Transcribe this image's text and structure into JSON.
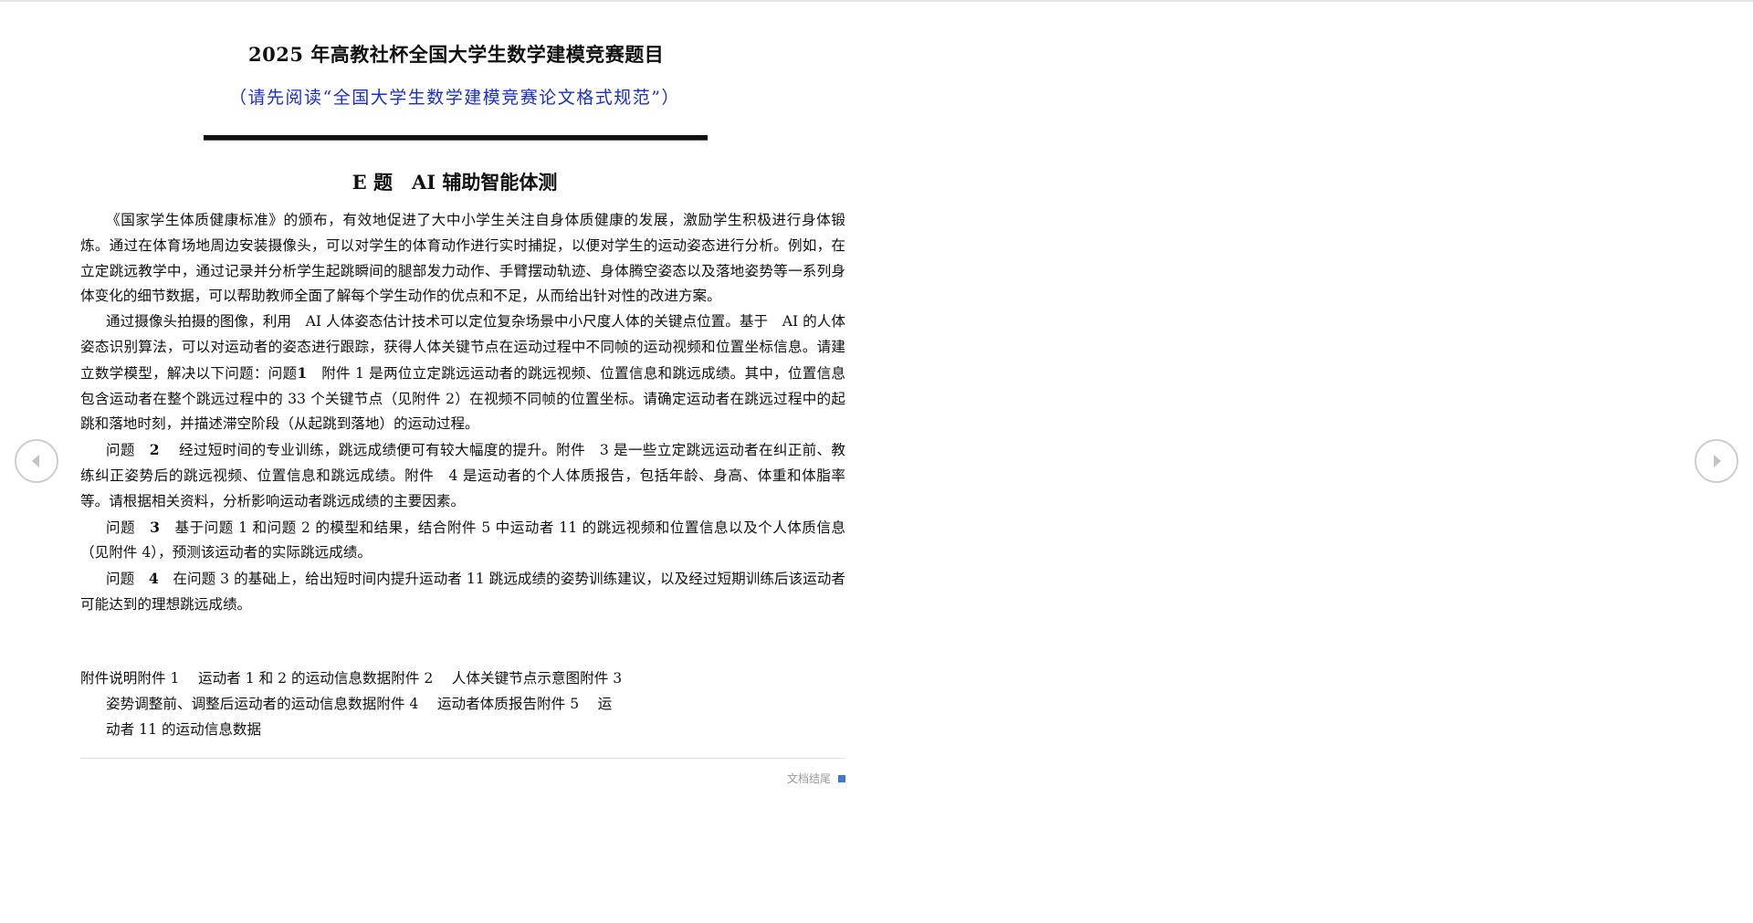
{
  "document": {
    "title": "2025 年高教社杯全国大学生数学建模竞赛题目",
    "subtitle": "（请先阅读“全国大学生数学建模竞赛论文格式规范”）",
    "problem_title": "E 题　AI 辅助智能体测",
    "paragraphs": {
      "p1": "《国家学生体质健康标准》的颁布，有效地促进了大中小学生关注自身体质健康的发展，激励学生积极进行身体锻炼。通过在体育场地周边安装摄像头，可以对学生的体育动作进行实时捕捉，以便对学生的运动姿态进行分析。例如，在立定跳远教学中，通过记录并分析学生起跳瞬间的腿部发力动作、手臂摆动轨迹、身体腾空姿态以及落地姿势等一系列身体变化的细节数据，可以帮助教师全面了解每个学生动作的优点和不足，从而给出针对性的改进方案。",
      "p2_intro": "通过摄像头拍摄的图像，利用　AI 人体姿态估计技术可以定位复杂场景中小尺度人体的关键点位置。基于　AI 的人体姿态识别算法，可以对运动者的姿态进行跟踪，获得人体关键节点在运动过程中不同帧的运动视频和位置坐标信息。请建立数学模型，解决以下问题：问题",
      "q1_num": "1",
      "q1_text": "　附件 1 是两位立定跳远运动者的跳远视频、位置信息和跳远成绩。其中，位置信息包含运动者在整个跳远过程中的 33 个关键节点（见附件 2）在视频不同帧的位置坐标。请确定运动者在跳远过程中的起跳和落地时刻，并描述滞空阶段（从起跳到落地）的运动过程。",
      "q2_label": "问题",
      "q2_num": "2",
      "q2_text": "　 经过短时间的专业训练，跳远成绩便可有较大幅度的提升。附件　3 是一些立定跳远运动者在纠正前、教练纠正姿势后的跳远视频、位置信息和跳远成绩。附件　4 是运动者的个人体质报告，包括年龄、身高、体重和体脂率等。请根据相关资料，分析影响运动者跳远成绩的主要因素。",
      "q3_label": "问题",
      "q3_num": "3",
      "q3_text": "　基于问题 1 和问题 2 的模型和结果，结合附件 5 中运动者 11 的跳远视频和位置信息以及个人体质信息（见附件 4），预测该运动者的实际跳远成绩。",
      "q4_label": "问题",
      "q4_num": "4",
      "q4_text": "　在问题 3 的基础上，给出短时间内提升运动者 11 跳远成绩的姿势训练建议，以及经过短期训练后该运动者可能达到的理想跳远成绩。"
    },
    "attachments": {
      "line1": "附件说明附件 1　 运动者 1 和 2 的运动信息数据附件 2　 人体关键节点示意图附件 3",
      "line2": "姿势调整前、调整后运动者的运动信息数据附件 4　 运动者体质报告附件 5　 运",
      "line3": "动者 11 的运动信息数据"
    },
    "end_label": "文档结尾"
  },
  "nav": {
    "prev_icon": "chevron-left-icon",
    "next_icon": "chevron-right-icon"
  },
  "colors": {
    "subtitle": "#1a2fc8",
    "end_marker": "#3e7bd0",
    "nav_border": "#cfcfcf"
  }
}
